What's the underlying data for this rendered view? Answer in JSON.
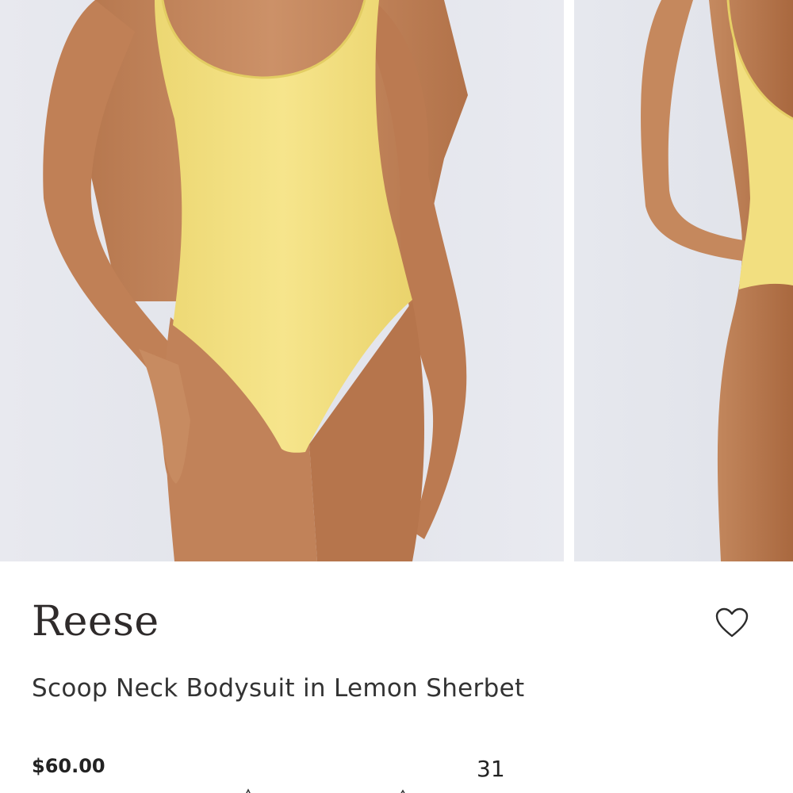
{
  "product": {
    "name": "Reese",
    "description": "Scoop Neck Bodysuit in Lemon Sherbet",
    "price": "$60.00",
    "review_count": "31"
  },
  "icons": {
    "wishlist": "heart-outline-icon"
  },
  "colors": {
    "photo_background": "#e4e6ed",
    "garment": "#f3e184",
    "skin": "#c5875c",
    "text": "#2f2b2b"
  }
}
